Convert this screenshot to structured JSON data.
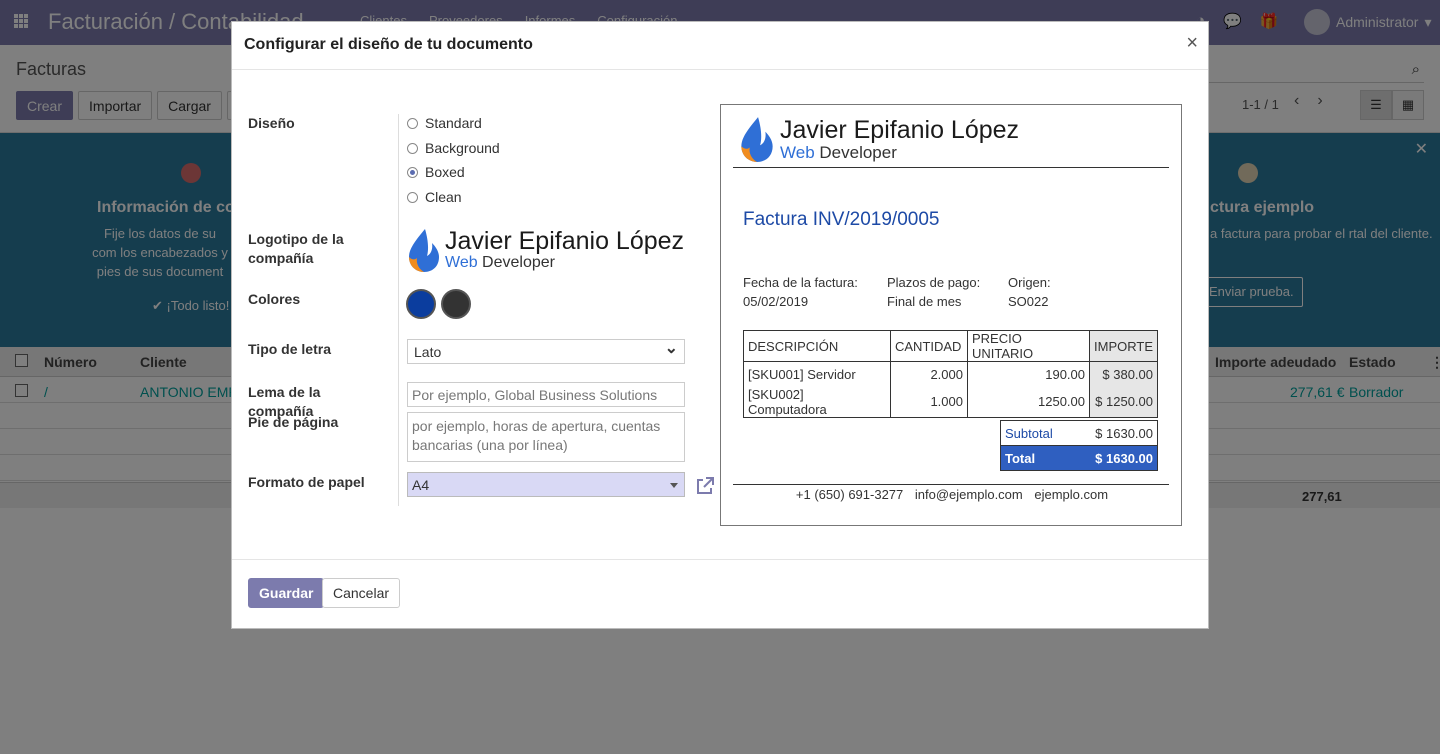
{
  "app": {
    "brand": "Facturación / Contabilidad",
    "menu": [
      "Clientes",
      "Proveedores",
      "Informes",
      "Configuración"
    ],
    "user": "Administrator",
    "breadcrumb": "Facturas",
    "buttons": {
      "create": "Crear",
      "import": "Importar",
      "upload": "Cargar"
    },
    "pager": "1-1 / 1",
    "banner": {
      "step1_title": "Información de co",
      "step1_text": "Fije los datos de su com los encabezados y pies de sus document",
      "step1_done": "✔ ¡Todo listo!",
      "step2_title": "ctura ejemplo",
      "step2_text": "a factura para probar el rtal del cliente.",
      "send_button": "Enviar prueba."
    },
    "list": {
      "headers": {
        "number": "Número",
        "customer": "Cliente",
        "amount_due": "Importe adeudado",
        "status": "Estado"
      },
      "row": {
        "number": "/",
        "customer": "ANTONIO EMP",
        "amount_due": "277,61 €",
        "status": "Borrador"
      },
      "total": "277,61"
    }
  },
  "modal": {
    "title": "Configurar el diseño de tu documento",
    "close": "×",
    "labels": {
      "layout": "Diseño",
      "logo": "Logotipo de la compañía",
      "colors": "Colores",
      "font": "Tipo de letra",
      "tagline": "Lema de la compañía",
      "footer": "Pie de página",
      "paper": "Formato de papel"
    },
    "layout_options": [
      "Standard",
      "Background",
      "Boxed",
      "Clean"
    ],
    "selected_layout": "Boxed",
    "logo": {
      "name": "Javier Epifanio López",
      "sub_a": "Web",
      "sub_b": " Developer"
    },
    "colors": {
      "primary": "#0b3d9e",
      "secondary": "#333333"
    },
    "font_value": "Lato",
    "tagline_placeholder": "Por ejemplo, Global Business Solutions",
    "footer_placeholder": "por ejemplo, horas de apertura, cuentas bancarias (una por línea)",
    "paper_value": "A4",
    "save": "Guardar",
    "cancel": "Cancelar"
  },
  "preview": {
    "invoice_title": "Factura INV/2019/0005",
    "meta": [
      {
        "label": "Fecha de la factura:",
        "value": "05/02/2019"
      },
      {
        "label": "Plazos de pago:",
        "value": "Final de mes"
      },
      {
        "label": "Origen:",
        "value": "SO022"
      }
    ],
    "table_headers": [
      "DESCRIPCIÓN",
      "CANTIDAD",
      "PRECIO UNITARIO",
      "IMPORTE"
    ],
    "lines": [
      {
        "desc": "[SKU001] Servidor",
        "qty": "2.000",
        "price": "190.00",
        "amount": "$ 380.00"
      },
      {
        "desc": "[SKU002] Computadora",
        "qty": "1.000",
        "price": "1250.00",
        "amount": "$ 1250.00"
      }
    ],
    "subtotal_label": "Subtotal",
    "subtotal_value": "$ 1630.00",
    "total_label": "Total",
    "total_value": "$ 1630.00",
    "footer": {
      "phone": "+1 (650) 691-3277",
      "email": "info@ejemplo.com",
      "web": "ejemplo.com"
    }
  }
}
